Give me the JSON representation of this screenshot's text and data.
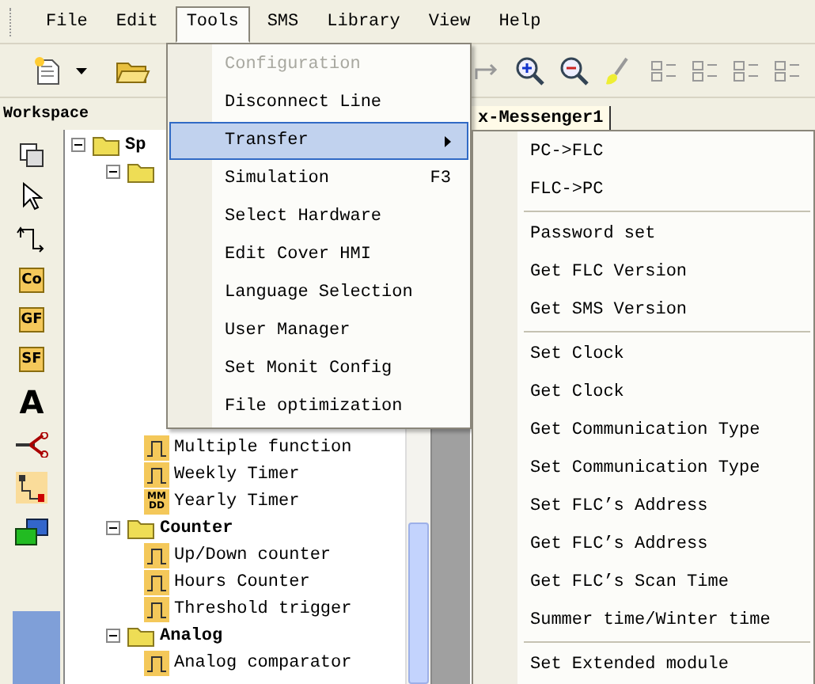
{
  "menubar": [
    {
      "label": "File",
      "selected": false
    },
    {
      "label": "Edit",
      "selected": false
    },
    {
      "label": "Tools",
      "selected": true
    },
    {
      "label": "SMS",
      "selected": false
    },
    {
      "label": "Library",
      "selected": false
    },
    {
      "label": "View",
      "selected": false
    },
    {
      "label": "Help",
      "selected": false
    }
  ],
  "workspace": {
    "title": "Workspace",
    "tool_labels": [
      "Co",
      "GF",
      "SF"
    ],
    "text_tool": "A",
    "tree": [
      {
        "kind": "folder",
        "label": "Sp",
        "expanded": true,
        "children": [
          {
            "kind": "folder",
            "expanded": true,
            "children": [
              {
                "kind": "leaf",
                "label": "Multiple function"
              },
              {
                "kind": "leaf",
                "label": "Weekly Timer"
              },
              {
                "kind": "leaf",
                "label": "Yearly Timer",
                "icon_text": "MM DD"
              }
            ]
          },
          {
            "kind": "folder",
            "label": "Counter",
            "expanded": true,
            "children": [
              {
                "kind": "leaf",
                "label": "Up/Down counter"
              },
              {
                "kind": "leaf",
                "label": "Hours Counter"
              },
              {
                "kind": "leaf",
                "label": "Threshold trigger"
              }
            ]
          },
          {
            "kind": "folder",
            "label": "Analog",
            "expanded": true,
            "children": [
              {
                "kind": "leaf",
                "label": "Analog comparator"
              }
            ]
          }
        ]
      }
    ]
  },
  "document_tab": {
    "title": "x-Messenger1"
  },
  "tools_menu": {
    "items": [
      {
        "kind": "item",
        "label": "Configuration",
        "disabled": true,
        "selected": false
      },
      {
        "kind": "item",
        "label": "Disconnect Line",
        "disabled": false,
        "selected": false
      },
      {
        "kind": "submenu",
        "label": "Transfer",
        "disabled": false,
        "selected": true
      },
      {
        "kind": "item",
        "label": "Simulation",
        "shortcut": "F3",
        "disabled": false,
        "selected": false
      },
      {
        "kind": "item",
        "label": "Select Hardware",
        "disabled": false,
        "selected": false
      },
      {
        "kind": "item",
        "label": "Edit Cover HMI",
        "disabled": false,
        "selected": false
      },
      {
        "kind": "item",
        "label": "Language Selection",
        "disabled": false,
        "selected": false
      },
      {
        "kind": "item",
        "label": "User Manager",
        "disabled": false,
        "selected": false
      },
      {
        "kind": "item",
        "label": "Set Monit Config",
        "disabled": false,
        "selected": false
      },
      {
        "kind": "item",
        "label": "File optimization",
        "disabled": false,
        "selected": false
      }
    ]
  },
  "transfer_submenu": {
    "items": [
      {
        "kind": "item",
        "label": "PC->FLC",
        "selected": false
      },
      {
        "kind": "item",
        "label": "FLC->PC",
        "selected": false
      },
      {
        "kind": "separator"
      },
      {
        "kind": "item",
        "label": "Password set",
        "selected": false
      },
      {
        "kind": "item",
        "label": "Get FLC Version",
        "selected": false
      },
      {
        "kind": "item",
        "label": "Get SMS Version",
        "selected": false
      },
      {
        "kind": "separator"
      },
      {
        "kind": "item",
        "label": "Set Clock",
        "selected": false
      },
      {
        "kind": "item",
        "label": "Get Clock",
        "selected": false
      },
      {
        "kind": "item",
        "label": "Get Communication Type",
        "selected": false
      },
      {
        "kind": "item",
        "label": "Set Communication Type",
        "selected": false
      },
      {
        "kind": "item",
        "label": "Set FLC’s Address",
        "selected": false
      },
      {
        "kind": "item",
        "label": "Get FLC’s Address",
        "selected": false
      },
      {
        "kind": "item",
        "label": "Get FLC’s Scan Time",
        "selected": false
      },
      {
        "kind": "item",
        "label": "Summer time/Winter time",
        "selected": false
      },
      {
        "kind": "separator"
      },
      {
        "kind": "item",
        "label": "Set Extended module",
        "selected": false
      }
    ]
  }
}
